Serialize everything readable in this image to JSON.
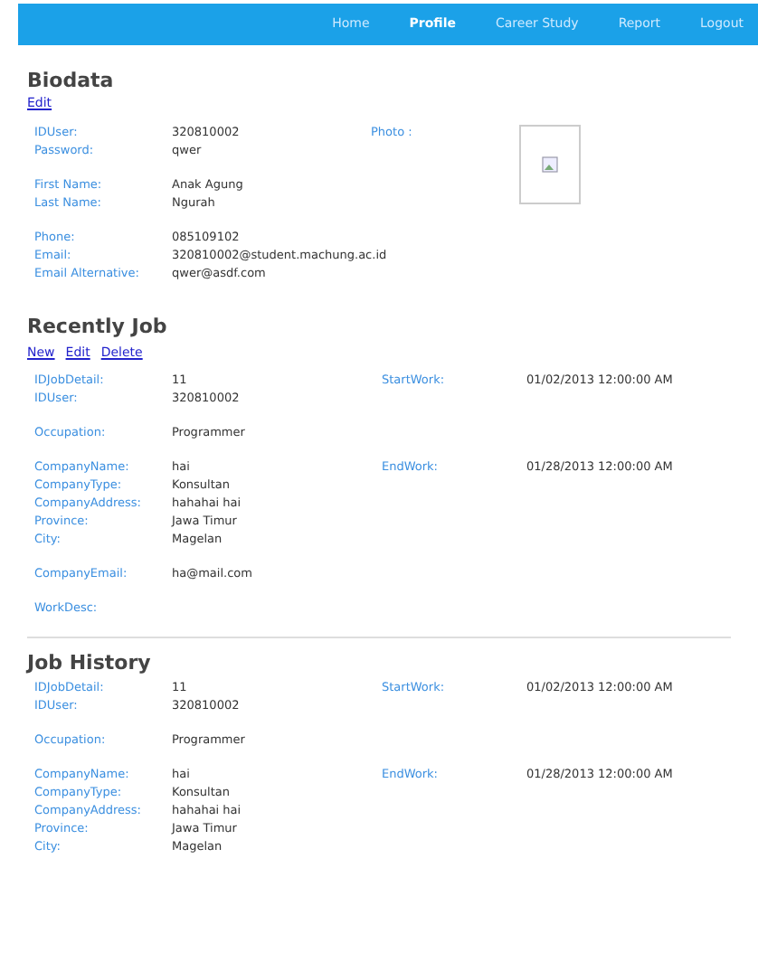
{
  "nav": [
    {
      "label": "Home",
      "selected": false
    },
    {
      "label": "Profile",
      "selected": true
    },
    {
      "label": "Career Study",
      "selected": false
    },
    {
      "label": "Report",
      "selected": false
    },
    {
      "label": "Logout",
      "selected": false
    }
  ],
  "biodata": {
    "title": "Biodata",
    "links": [
      "Edit"
    ],
    "photo_label": "Photo :",
    "groups": [
      [
        {
          "label": "IDUser:",
          "value": "320810002"
        },
        {
          "label": "Password:",
          "value": "qwer"
        }
      ],
      [
        {
          "label": "First Name:",
          "value": "Anak Agung"
        },
        {
          "label": "Last Name:",
          "value": "Ngurah"
        }
      ],
      [
        {
          "label": "Phone:",
          "value": "085109102"
        },
        {
          "label": "Email:",
          "value": "320810002@student.machung.ac.id"
        },
        {
          "label": "Email Alternative:",
          "value": "qwer@asdf.com"
        }
      ]
    ]
  },
  "jobs": [
    {
      "title": "Recently Job",
      "links": [
        "New",
        "Edit",
        "Delete"
      ],
      "groups": [
        [
          {
            "label": "IDJobDetail:",
            "value": "11",
            "right_label": "StartWork:",
            "right_value": "01/02/2013 12:00:00 AM"
          },
          {
            "label": "IDUser:",
            "value": "320810002"
          }
        ],
        [
          {
            "label": "Occupation:",
            "value": "Programmer"
          }
        ],
        [
          {
            "label": "CompanyName:",
            "value": "hai",
            "right_label": "EndWork:",
            "right_value": "01/28/2013 12:00:00 AM"
          },
          {
            "label": "CompanyType:",
            "value": "Konsultan"
          },
          {
            "label": "CompanyAddress:",
            "value": "hahahai hai"
          },
          {
            "label": "Province:",
            "value": "Jawa Timur"
          },
          {
            "label": "City:",
            "value": "Magelan"
          }
        ],
        [
          {
            "label": "CompanyEmail:",
            "value": "ha@mail.com"
          }
        ],
        [
          {
            "label": "WorkDesc:"
          }
        ]
      ]
    },
    {
      "title": "Job History",
      "groups": [
        [
          {
            "label": "IDJobDetail:",
            "value": "11",
            "right_label": "StartWork:",
            "right_value": "01/02/2013 12:00:00 AM"
          },
          {
            "label": "IDUser:",
            "value": "320810002"
          }
        ],
        [
          {
            "label": "Occupation:",
            "value": "Programmer"
          }
        ],
        [
          {
            "label": "CompanyName:",
            "value": "hai",
            "right_label": "EndWork:",
            "right_value": "01/28/2013 12:00:00 AM"
          },
          {
            "label": "CompanyType:",
            "value": "Konsultan"
          },
          {
            "label": "CompanyAddress:",
            "value": "hahahai hai"
          },
          {
            "label": "Province:",
            "value": "Jawa Timur"
          },
          {
            "label": "City:",
            "value": "Magelan"
          }
        ]
      ]
    }
  ]
}
